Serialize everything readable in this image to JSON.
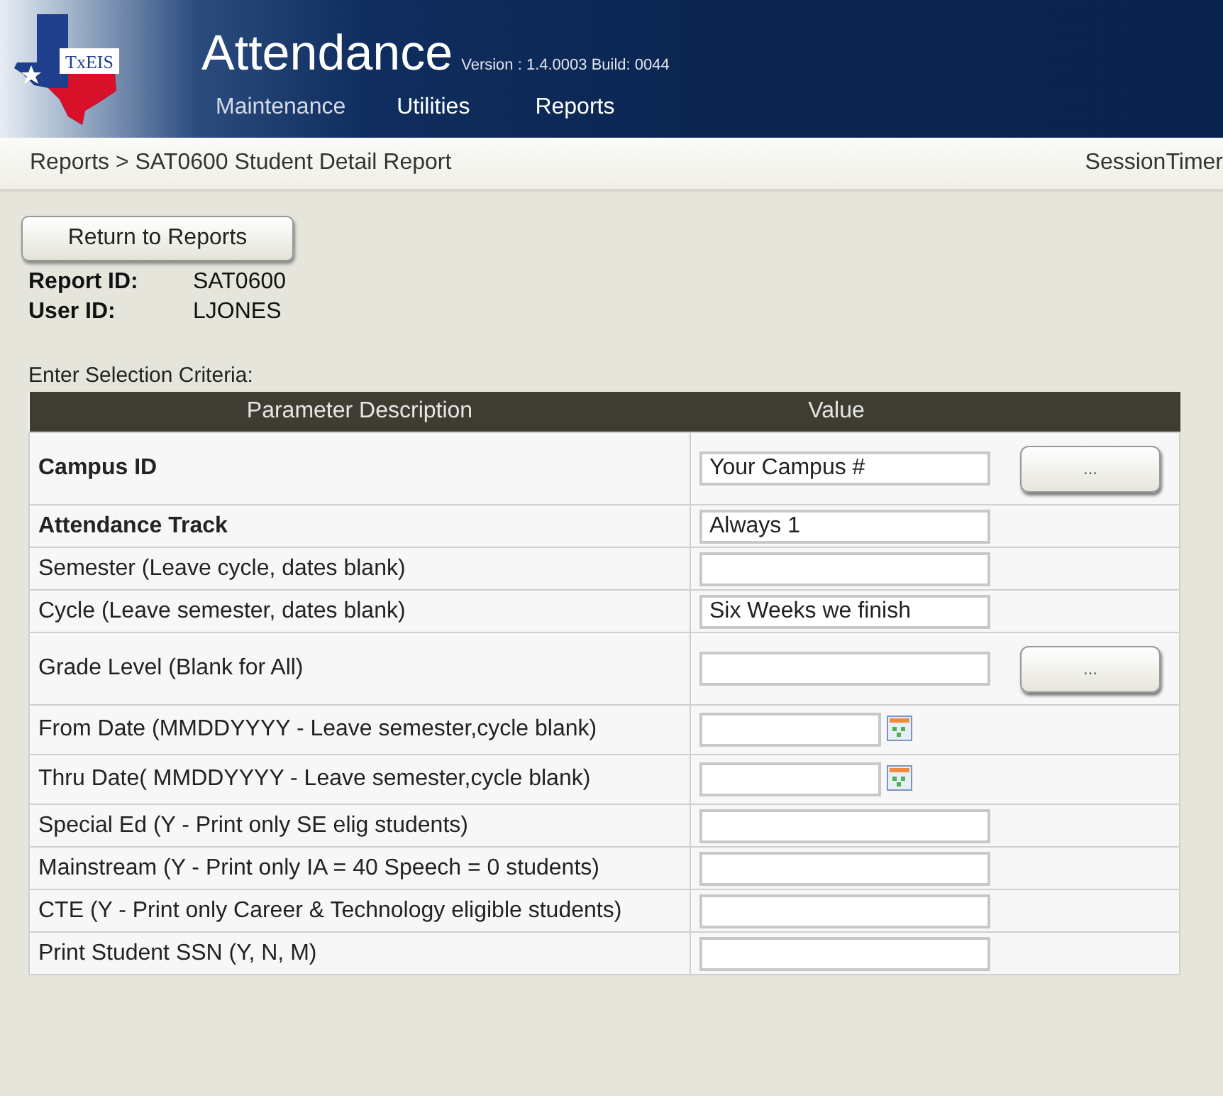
{
  "header": {
    "logo_text": "TxEIS",
    "title": "Attendance",
    "version": "Version : 1.4.0003 Build: 0044",
    "menu": [
      "Maintenance",
      "Utilities",
      "Reports"
    ]
  },
  "breadcrumb": {
    "path": "Reports > SAT0600 Student Detail Report",
    "session": "SessionTimer"
  },
  "return_button": "Return to Reports",
  "info": [
    {
      "label": "Report ID:",
      "value": "SAT0600"
    },
    {
      "label": "User ID:",
      "value": "LJONES"
    }
  ],
  "criteria_label": "Enter Selection Criteria:",
  "table": {
    "columns": [
      "Parameter Description",
      "Value"
    ],
    "rows": [
      {
        "kind": "lookup",
        "label": "Campus ID",
        "required": true,
        "value": "Your Campus #",
        "button_label": "..."
      },
      {
        "kind": "text",
        "label": "Attendance Track",
        "required": true,
        "value": "Always 1"
      },
      {
        "kind": "text",
        "label": "Semester (Leave cycle, dates blank)",
        "required": false
      },
      {
        "kind": "text",
        "label": "Cycle (Leave semester, dates blank)",
        "required": false,
        "value": "Six Weeks we finish"
      },
      {
        "kind": "lookup",
        "label": "Grade Level (Blank for All)",
        "required": false,
        "button_label": "..."
      },
      {
        "kind": "date",
        "label": "From Date (MMDDYYYY - Leave semester,cycle blank)",
        "required": false
      },
      {
        "kind": "date",
        "label": "Thru Date( MMDDYYYY - Leave semester,cycle blank)",
        "required": false
      },
      {
        "kind": "text",
        "label": "Special Ed (Y - Print only SE elig students)",
        "required": false
      },
      {
        "kind": "text",
        "label": "Mainstream (Y - Print only IA = 40 Speech = 0 students)",
        "required": false
      },
      {
        "kind": "text",
        "label": "CTE (Y - Print only Career & Technology eligible students)",
        "required": false
      },
      {
        "kind": "text",
        "label": "Print Student SSN (Y, N, M)",
        "required": false
      }
    ]
  }
}
